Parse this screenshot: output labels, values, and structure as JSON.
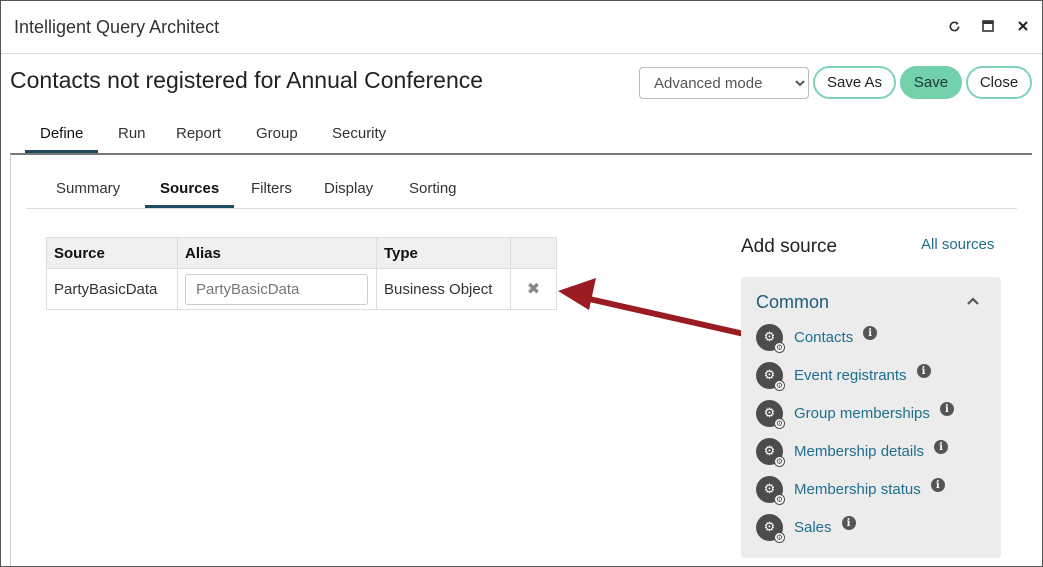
{
  "window": {
    "title": "Intelligent Query Architect",
    "controls": [
      "refresh-icon",
      "maximize-icon",
      "close-icon"
    ]
  },
  "page": {
    "title": "Contacts not registered for Annual Conference"
  },
  "toolbar": {
    "mode_value": "Advanced mode",
    "save_as_label": "Save As",
    "save_label": "Save",
    "close_label": "Close"
  },
  "main_tabs": [
    {
      "label": "Define",
      "active": true
    },
    {
      "label": "Run"
    },
    {
      "label": "Report"
    },
    {
      "label": "Group"
    },
    {
      "label": "Security"
    }
  ],
  "sub_tabs": [
    {
      "label": "Summary"
    },
    {
      "label": "Sources",
      "active": true
    },
    {
      "label": "Filters"
    },
    {
      "label": "Display"
    },
    {
      "label": "Sorting"
    }
  ],
  "sources_table": {
    "headers": [
      "Source",
      "Alias",
      "Type",
      ""
    ],
    "rows": [
      {
        "source": "PartyBasicData",
        "alias": "PartyBasicData",
        "type": "Business Object",
        "remove_icon": "remove-x-icon"
      }
    ]
  },
  "add_source": {
    "title": "Add source",
    "all_sources_label": "All sources",
    "group": {
      "title": "Common",
      "items": [
        "Contacts",
        "Event registrants",
        "Group memberships",
        "Membership details",
        "Membership status",
        "Sales"
      ]
    }
  },
  "colors": {
    "accent": "#72d0ab",
    "link": "#1f6e8c",
    "tab_underline": "#1f4a5f",
    "arrow": "#9b1b22"
  }
}
